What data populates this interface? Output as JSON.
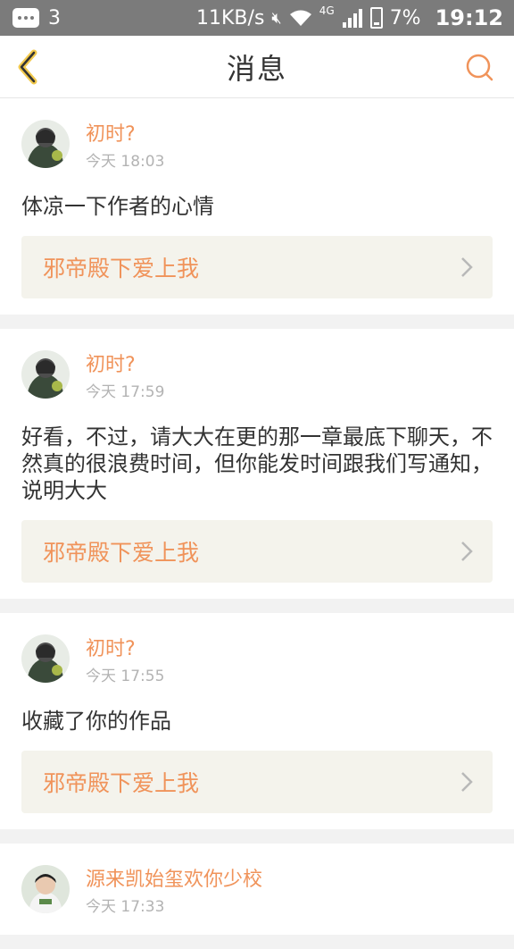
{
  "status_bar": {
    "notification_count": "3",
    "network_speed": "11KB/s",
    "network_type": "4G",
    "battery": "7%",
    "time": "19:12"
  },
  "nav": {
    "title": "消息"
  },
  "colors": {
    "accent": "#f0935a",
    "card_link_bg": "#f4f3ec",
    "status_bar_bg": "#7b7b7b"
  },
  "messages": [
    {
      "username": "初时?",
      "time": "今天 18:03",
      "content": "体凉一下作者的心情",
      "work_title": "邪帝殿下爱上我"
    },
    {
      "username": "初时?",
      "time": "今天 17:59",
      "content": "好看，不过，请大大在更的那一章最底下聊天，不然真的很浪费时间，但你能发时间跟我们写通知，说明大大",
      "work_title": "邪帝殿下爱上我"
    },
    {
      "username": "初时?",
      "time": "今天 17:55",
      "content": "收藏了你的作品",
      "work_title": "邪帝殿下爱上我"
    },
    {
      "username": "源来凯始玺欢你少校",
      "time": "今天 17:33"
    }
  ]
}
